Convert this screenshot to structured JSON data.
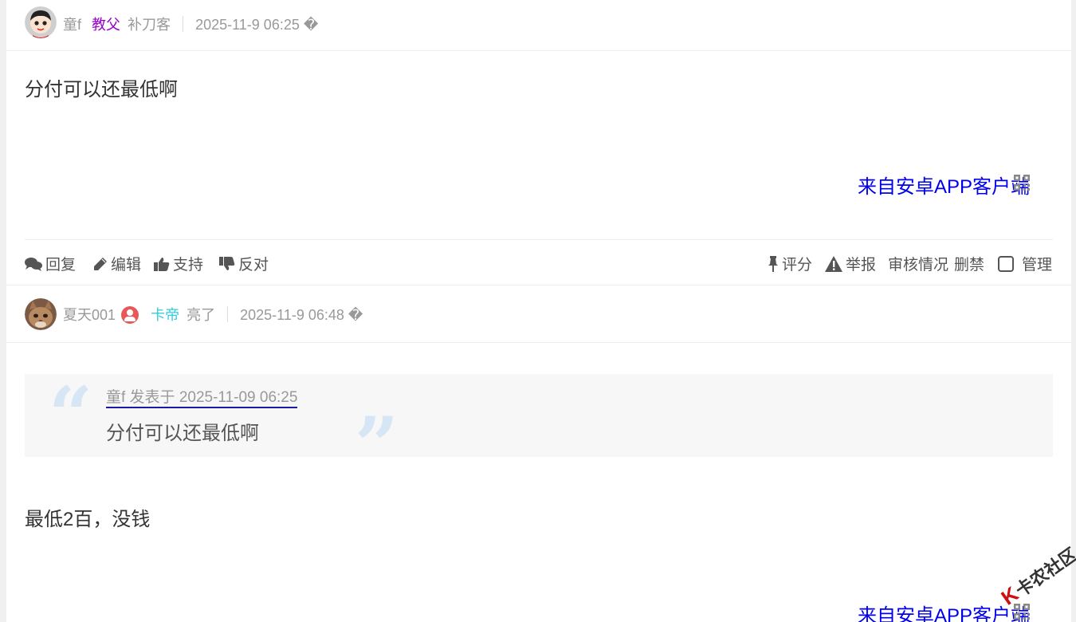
{
  "posts": [
    {
      "author": "童f",
      "rank": "教父",
      "status": "补刀客",
      "time": "2025-11-9 06:25 �",
      "content": "分付可以还最低啊",
      "from_app": "来自安卓APP客户端"
    },
    {
      "author": "夏天001",
      "rank": "卡帝",
      "status": "亮了",
      "time": "2025-11-9 06:48 �",
      "quote": {
        "source": "童f 发表于 2025-11-09 06:25",
        "text": "分付可以还最低啊"
      },
      "content": "最低2百，没钱",
      "from_app": "来自安卓APP客户端"
    }
  ],
  "actions": {
    "reply": "回复",
    "edit": "编辑",
    "support": "支持",
    "oppose": "反对",
    "rate": "评分",
    "report": "举报",
    "review": "审核情况",
    "ban": "删禁",
    "manage": "管理"
  },
  "watermark": {
    "mark": "K",
    "text": "卡农社区"
  },
  "colors": {
    "link_blue": "#0000ee",
    "rank_purple": "#9900cc",
    "rank_cyan": "#33ccdd",
    "quote_mark": "#d6e6f5"
  }
}
